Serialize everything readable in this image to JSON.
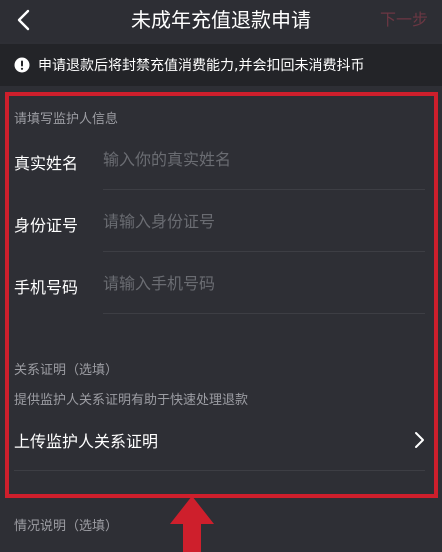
{
  "nav": {
    "title": "未成年充值退款申请",
    "next_label": "下一步"
  },
  "notice": {
    "text": "申请退款后将封禁充值消费能力,并会扣回未消费抖币"
  },
  "guardian": {
    "section_title": "请填写监护人信息",
    "fields": [
      {
        "label": "真实姓名",
        "placeholder": "输入你的真实姓名",
        "value": ""
      },
      {
        "label": "身份证号",
        "placeholder": "请输入身份证号",
        "value": ""
      },
      {
        "label": "手机号码",
        "placeholder": "请输入手机号码",
        "value": ""
      }
    ]
  },
  "relation": {
    "section_title": "关系证明（选填）",
    "hint": "提供监护人关系证明有助于快速处理退款",
    "upload_label": "上传监护人关系证明"
  },
  "situation": {
    "section_title": "情况说明（选填）"
  },
  "colors": {
    "background": "#2e2f35",
    "notice_bg": "#232428",
    "annotation_red": "#ce1f2c",
    "next_disabled": "#6b3743"
  }
}
